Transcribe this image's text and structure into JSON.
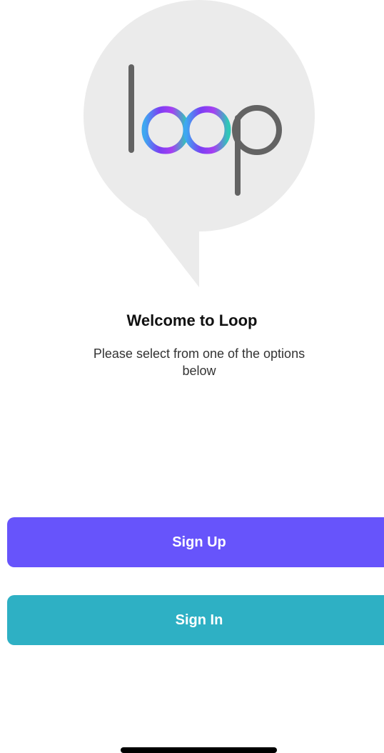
{
  "logo": {
    "icon": "loop-speech-bubble-logo",
    "text": "loop",
    "bubble_color": "#ebebeb",
    "letter_color": "#636363",
    "gradient_colors": [
      "#3ea8f0",
      "#7b3ff3",
      "#a63ff2",
      "#2fc7b8"
    ]
  },
  "welcome": {
    "title": "Welcome to Loop",
    "subtitle": "Please select from one of the options below"
  },
  "buttons": {
    "sign_up": {
      "label": "Sign Up",
      "color": "#6754fb"
    },
    "sign_in": {
      "label": "Sign In",
      "color": "#2eb0c4"
    }
  }
}
